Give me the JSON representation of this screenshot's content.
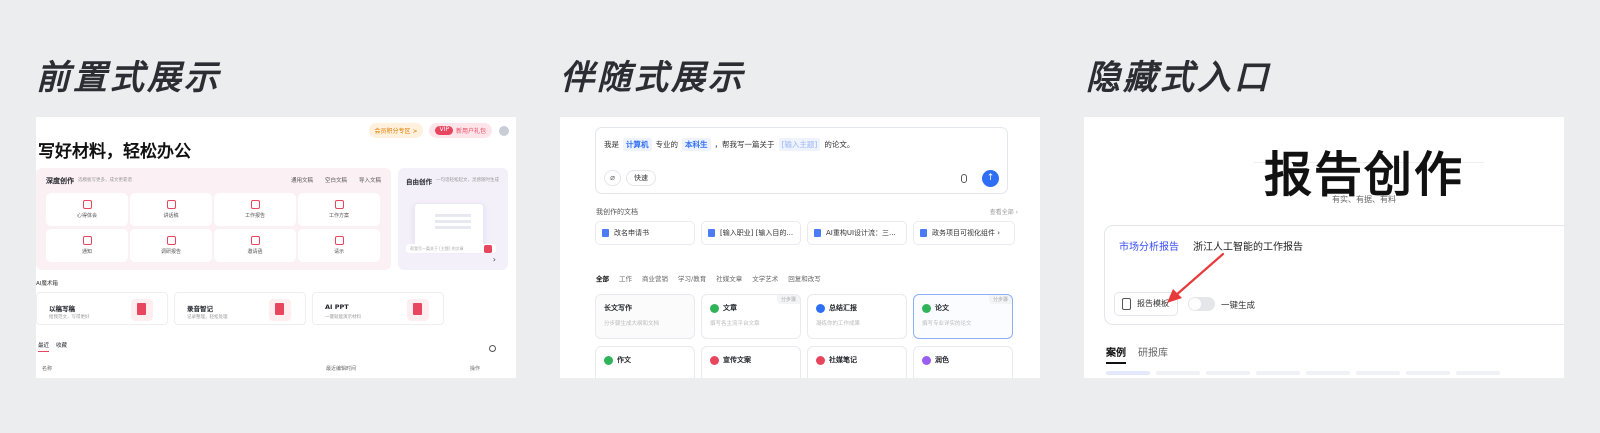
{
  "headings": {
    "p1": "前置式展示",
    "p2": "伴随式展示",
    "p3": "隐藏式入口"
  },
  "panel1": {
    "pill_a": "会员积分专区 >",
    "pill_b_badge": "VIP",
    "pill_b": "新用户礼包",
    "title": "写好材料，轻松办公",
    "deep": {
      "title": "深度创作",
      "sub": "选模板写更多，成文更靠谱",
      "links": [
        "通用文稿",
        "空白文稿",
        "导入文稿"
      ],
      "tiles": [
        "心得体会",
        "讲话稿",
        "工作报告",
        "工作方案",
        "通知",
        "调研报告",
        "邀请函",
        "请示"
      ]
    },
    "free": {
      "title": "自由创作",
      "sub": "一句话轻松起文，灵感随时生成",
      "input": "帮我写一篇关于 [主题] 的文章",
      "arrow": "›"
    },
    "section": "AI魔术箱",
    "tools": [
      {
        "name": "以稿写稿",
        "desc": "给我范文，写得更好"
      },
      {
        "name": "录音智记",
        "desc": "记录整理，轻松处理"
      },
      {
        "name": "AI PPT",
        "desc": "一键就能演示材料"
      }
    ],
    "tabs": [
      "最近",
      "收藏"
    ],
    "cols": [
      "名称",
      "最近编辑时间",
      "操作"
    ]
  },
  "panel2": {
    "prompt": {
      "a": "我是",
      "b": "计算机",
      "c": "专业的",
      "d": "本科生",
      "e": "，帮我写一篇关于",
      "f": "[输入主题]",
      "g": "的论文。"
    },
    "clip": "⌀",
    "fast": "快速",
    "send": "↑",
    "mydocs": "我创作的文档",
    "viewall": "查看全部 ›",
    "docs": [
      "改名申请书",
      "[输入职业] [输入目的...",
      "AI重构UI设计流：三...",
      "政务项目可视化组件 ›"
    ],
    "tabs": [
      "全部",
      "工作",
      "商业营销",
      "学习/教育",
      "社媒文章",
      "文学艺术",
      "回复和改写"
    ],
    "cards": [
      {
        "name": "长文写作",
        "desc": "分步骤生成大纲和文档",
        "color": "",
        "tag": ""
      },
      {
        "name": "文章",
        "desc": "撰写各主流平台文章",
        "color": "#2fb45a",
        "tag": "分步骤"
      },
      {
        "name": "总结汇报",
        "desc": "凝练你的工作成果",
        "color": "#2f6ff5",
        "tag": ""
      },
      {
        "name": "论文",
        "desc": "撰写专业详实的论文",
        "color": "#2fb45a",
        "tag": "分步骤"
      },
      {
        "name": "作文",
        "desc": "",
        "color": "#2fb45a",
        "tag": ""
      },
      {
        "name": "宣传文案",
        "desc": "",
        "color": "#e8455e",
        "tag": ""
      },
      {
        "name": "社媒笔记",
        "desc": "",
        "color": "#e8455e",
        "tag": ""
      },
      {
        "name": "润色",
        "desc": "",
        "color": "#9a5ef0",
        "tag": ""
      }
    ]
  },
  "panel3": {
    "title": "报告创作",
    "tagline": "有实、有据、有料",
    "label": "市场分析报告",
    "value": "浙江人工智能的工作报告",
    "template": "报告模板",
    "oneclick": "一键生成",
    "tabs": [
      "案例",
      "研报库"
    ]
  }
}
